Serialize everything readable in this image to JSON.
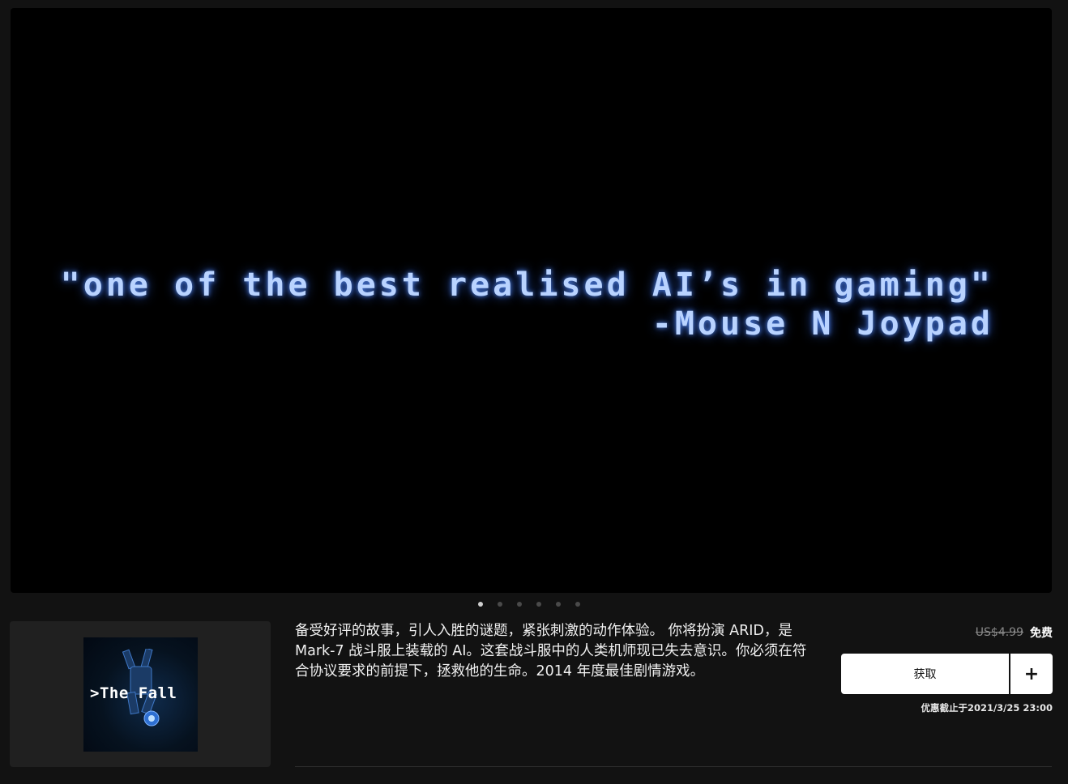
{
  "hero": {
    "quote_line1": "\"one of the best realised AI’s in gaming\"",
    "quote_line2": "-Mouse N Joypad",
    "quote_color": "#b9d3ff",
    "glow_color": "#4f7fe0"
  },
  "carousel": {
    "slide_count": 6,
    "active_index": 0
  },
  "game": {
    "cover_title": ">The Fall",
    "description": "备受好评的故事，引人入胜的谜题，紧张刺激的动作体验。 你将扮演 ARID，是 Mark-7 战斗服上装载的 AI。这套战斗服中的人类机师现已失去意识。你必须在符合协议要求的前提下，拯救他的生命。2014 年度最佳剧情游戏。"
  },
  "purchase": {
    "original_price": "US$4.99",
    "current_price": "免费",
    "get_label": "获取",
    "add_label": "+",
    "deal_end": "优惠截止于2021/3/25 23:00"
  },
  "colors": {
    "background": "#121212",
    "card": "#202020",
    "button": "#ffffff"
  }
}
